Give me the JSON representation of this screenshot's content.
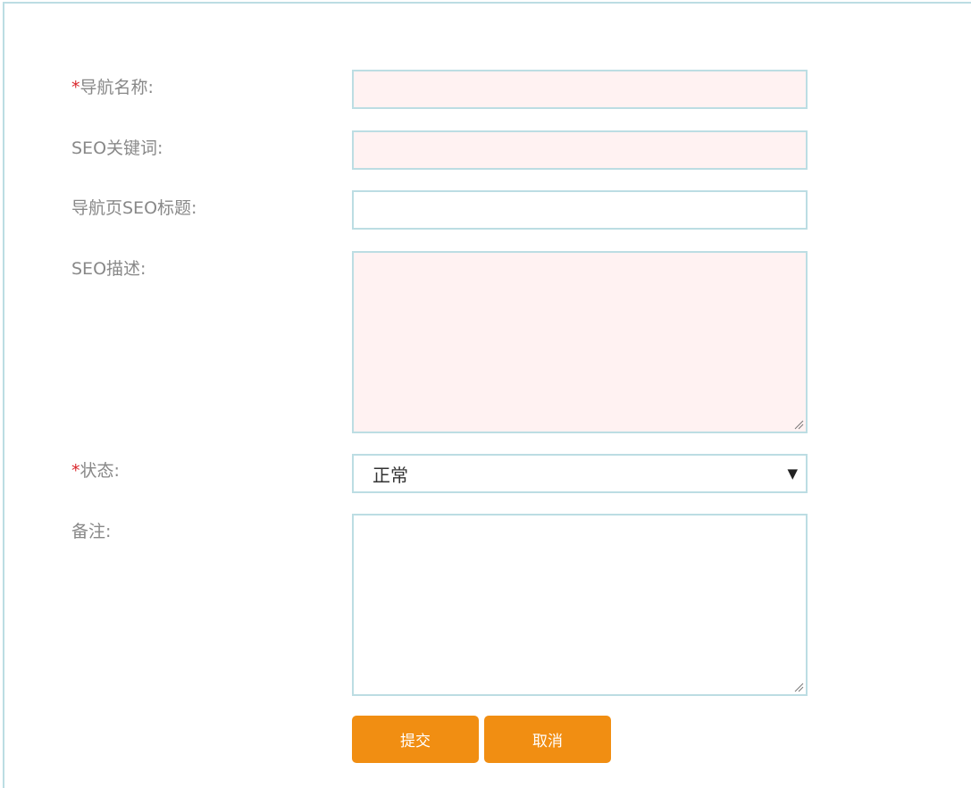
{
  "form": {
    "nav_name": {
      "required_mark": "*",
      "label": "导航名称:",
      "value": ""
    },
    "seo_keywords": {
      "label": "SEO关键词:",
      "value": ""
    },
    "seo_title": {
      "label": "导航页SEO标题:",
      "value": ""
    },
    "seo_description": {
      "label": "SEO描述:",
      "value": ""
    },
    "status": {
      "required_mark": "*",
      "label": "状态:",
      "selected": "正常"
    },
    "remark": {
      "label": "备注:",
      "value": ""
    }
  },
  "buttons": {
    "submit_label": "提交",
    "cancel_label": "取消"
  },
  "colors": {
    "accent": "#f18e12",
    "border": "#bcdde3",
    "invalid_field_bg": "#fff2f2",
    "required": "#d9262b",
    "label": "#888888"
  },
  "icons": {
    "select_arrow": "triangle-down-icon",
    "resize_grip": "resize-grip-icon"
  }
}
